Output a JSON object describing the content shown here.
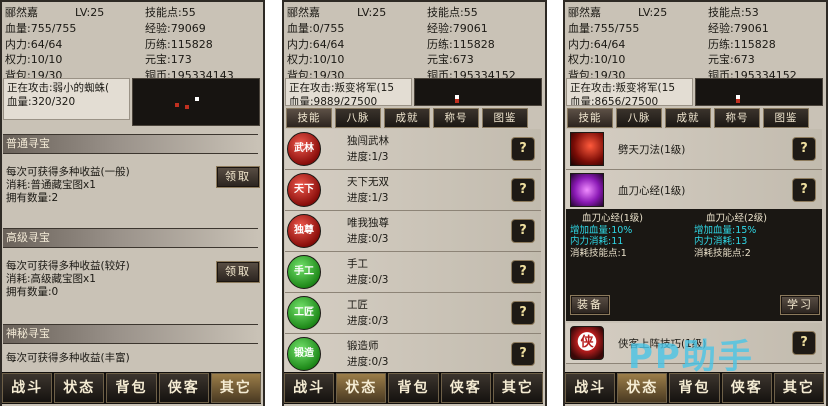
{
  "panels": [
    {
      "stats": {
        "name": "郦然嘉",
        "level": "LV:25",
        "skill_points": "技能点:55",
        "hp": "血量:755/755",
        "exp": "经验:79069",
        "mp": "内力:64/64",
        "training": "历练:115828",
        "power": "权力:10/10",
        "ingot": "元宝:173",
        "bag": "背包:19/30",
        "copper": "铜币:195334143"
      },
      "attack": {
        "target": "正在攻击:弱小的蜘蛛(",
        "hp": "血量:320/320"
      },
      "treasures": [
        {
          "title": "普通寻宝",
          "desc": "每次可获得多种收益(一般)",
          "cost": "消耗:普通藏宝图x1",
          "count": "拥有数量:2",
          "button": "领取"
        },
        {
          "title": "高级寻宝",
          "desc": "每次可获得多种收益(较好)",
          "cost": "消耗:高级藏宝图x1",
          "count": "拥有数量:0",
          "button": "领取"
        },
        {
          "title": "神秘寻宝",
          "desc": "每次可获得多种收益(丰富)"
        }
      ],
      "nav": [
        "战斗",
        "状态",
        "背包",
        "侠客",
        "其它"
      ],
      "nav_active": 4
    },
    {
      "stats": {
        "name": "郦然嘉",
        "level": "LV:25",
        "skill_points": "技能点:55",
        "hp": "血量:0/755",
        "exp": "经验:79061",
        "mp": "内力:64/64",
        "training": "历练:115828",
        "power": "权力:10/10",
        "ingot": "元宝:673",
        "bag": "背包:19/30",
        "copper": "铜币:195334152"
      },
      "attack": {
        "target": "正在攻击:叛变将军(15",
        "hp": "血量:9889/27500"
      },
      "tabs": [
        "技能",
        "八脉",
        "成就",
        "称号",
        "图鉴"
      ],
      "achievements": [
        {
          "name": "独闯武林",
          "progress": "进度:1/3",
          "icon_text": "武林",
          "icon_color": "red",
          "icon": "achievement-wulin-icon"
        },
        {
          "name": "天下无双",
          "progress": "进度:1/3",
          "icon_text": "天下",
          "icon_color": "red",
          "icon": "achievement-tianxia-icon"
        },
        {
          "name": "唯我独尊",
          "progress": "进度:0/3",
          "icon_text": "独尊",
          "icon_color": "red",
          "icon": "achievement-duzun-icon"
        },
        {
          "name": "手工",
          "progress": "进度:0/3",
          "icon_text": "手工",
          "icon_color": "green",
          "icon": "achievement-shougong-icon"
        },
        {
          "name": "工匠",
          "progress": "进度:0/3",
          "icon_text": "工匠",
          "icon_color": "green",
          "icon": "achievement-gongjiang-icon"
        },
        {
          "name": "锻造师",
          "progress": "进度:0/3",
          "icon_text": "锻造",
          "icon_color": "green",
          "icon": "achievement-duanzao-icon"
        }
      ],
      "nav": [
        "战斗",
        "状态",
        "背包",
        "侠客",
        "其它"
      ],
      "nav_active": 1
    },
    {
      "stats": {
        "name": "郦然嘉",
        "level": "LV:25",
        "skill_points": "技能点:53",
        "hp": "血量:755/755",
        "exp": "经验:79061",
        "mp": "内力:64/64",
        "training": "历练:115828",
        "power": "权力:10/10",
        "ingot": "元宝:673",
        "bag": "背包:19/30",
        "copper": "铜币:195334152"
      },
      "attack": {
        "target": "正在攻击:叛变将军(15",
        "hp": "血量:8656/27500"
      },
      "tabs": [
        "技能",
        "八脉",
        "成就",
        "称号",
        "图鉴"
      ],
      "skills": [
        {
          "name": "劈天刀法(1级)",
          "icon": "blade-slash-icon"
        },
        {
          "name": "血刀心经(1级)",
          "icon": "blood-blade-icon"
        }
      ],
      "detail": {
        "current": {
          "title": "血刀心经(1级)",
          "l1": "增加血量:10%",
          "l2": "内力消耗:11",
          "l3": "消耗技能点:1"
        },
        "next": {
          "title": "血刀心经(2级)",
          "l1": "增加血量:15%",
          "l2": "内力消耗:13",
          "l3": "消耗技能点:2"
        }
      },
      "equip_label": "装备",
      "learn_label": "学习",
      "skill3_name": "侠客上阵技巧(1级)",
      "nav": [
        "战斗",
        "状态",
        "背包",
        "侠客",
        "其它"
      ],
      "nav_active": 1
    }
  ],
  "watermark": "PP助手",
  "colors": {
    "accent_gold": "#9b7d49",
    "detail_cyan": "#2fd8e6"
  }
}
